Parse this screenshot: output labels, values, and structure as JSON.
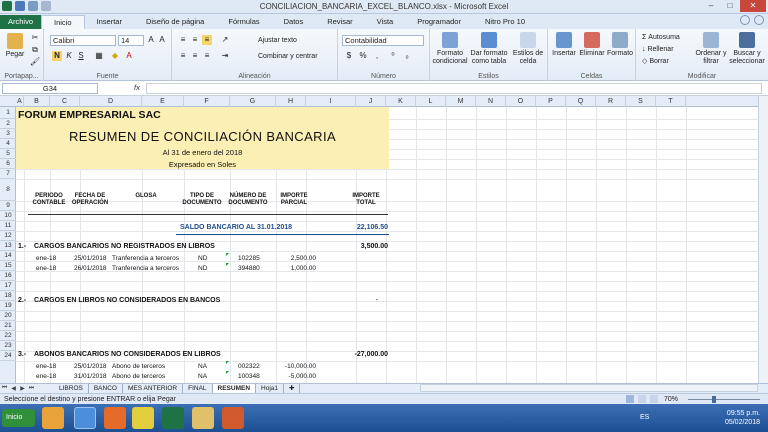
{
  "window": {
    "title": "CONCILIACION_BANCARIA_EXCEL_BLANCO.xlsx - Microsoft Excel",
    "minimize": "–",
    "maximize": "□",
    "close": "✕"
  },
  "tabs": [
    "Inicio",
    "Insertar",
    "Diseño de página",
    "Fórmulas",
    "Datos",
    "Revisar",
    "Vista",
    "Programador",
    "Nitro Pro 10"
  ],
  "file_tab": "Archivo",
  "ribbon": {
    "clipboard": {
      "label": "Portapap...",
      "paste": "Pegar"
    },
    "font": {
      "label": "Fuente",
      "name": "Calibri",
      "size": "14",
      "bold": "N",
      "italic": "K",
      "underline": "S"
    },
    "alignment": {
      "label": "Alineación",
      "wrap": "Ajustar texto",
      "merge": "Combinar y centrar"
    },
    "number": {
      "label": "Número",
      "format": "Contabilidad"
    },
    "styles": {
      "label": "Estilos",
      "conditional": "Formato condicional",
      "table": "Dar formato como tabla",
      "cell": "Estilos de celda"
    },
    "cells": {
      "label": "Celdas",
      "insert": "Insertar",
      "delete": "Eliminar",
      "format": "Formato"
    },
    "editing": {
      "label": "Modificar",
      "autosum": "Autosuma",
      "fill": "Rellenar",
      "clear": "Borrar",
      "sort": "Ordenar y filtrar",
      "find": "Buscar y seleccionar"
    }
  },
  "formula_bar": {
    "name_box": "G34",
    "fx": "fx",
    "value": ""
  },
  "columns": [
    "A",
    "B",
    "C",
    "D",
    "E",
    "F",
    "G",
    "H",
    "I",
    "J",
    "K",
    "L",
    "M",
    "N",
    "O",
    "P",
    "Q",
    "R",
    "S",
    "T"
  ],
  "rows": [
    "1",
    "2",
    "3",
    "4",
    "5",
    "6",
    "7",
    "8",
    "9",
    "10",
    "11",
    "12",
    "13",
    "14",
    "15",
    "16",
    "17",
    "18",
    "19",
    "20",
    "21",
    "22",
    "23",
    "24"
  ],
  "sheet": {
    "company": "FORUM EMPRESARIAL SAC",
    "title": "RESUMEN DE CONCILIACIÓN BANCARIA",
    "date": "Al 31 de enero del 2018",
    "currency": "Expresado en Soles",
    "headers": {
      "periodo": "PERIODO CONTABLE",
      "fecha": "FECHA DE OPERACIÓN",
      "glosa": "GLOSA",
      "tipo": "TIPO DE DOCUMENTO",
      "numero": "NÚMERO DE DOCUMENTO",
      "parcial": "IMPORTE PARCIAL",
      "total": "IMPORTE TOTAL"
    },
    "saldo_label": "SALDO BANCARIO AL 31.01.2018",
    "saldo_value": "22,106.50",
    "s1_num": "1.-",
    "s1_label": "CARGOS BANCARIOS NO REGISTRADOS EN LIBROS",
    "s1_total": "3,500.00",
    "s1_rows": [
      {
        "periodo": "ene-18",
        "fecha": "25/01/2018",
        "glosa": "Tranferencia a terceros",
        "tipo": "ND",
        "numero": "102285",
        "parcial": "2,500.00"
      },
      {
        "periodo": "ene-18",
        "fecha": "26/01/2018",
        "glosa": "Tranferencia a terceros",
        "tipo": "ND",
        "numero": "394880",
        "parcial": "1,000.00"
      }
    ],
    "s2_num": "2.-",
    "s2_label": "CARGOS EN LIBROS NO CONSIDERADOS EN BANCOS",
    "s2_total": "-",
    "s3_num": "3.-",
    "s3_label": "ABONOS BANCARIOS NO CONSIDERADOS EN LIBROS",
    "s3_total": "-27,000.00",
    "s3_rows": [
      {
        "periodo": "ene-18",
        "fecha": "25/01/2018",
        "glosa": "Abono de terceros",
        "tipo": "NA",
        "numero": "002322",
        "parcial": "-10,000.00"
      },
      {
        "periodo": "ene-18",
        "fecha": "31/01/2018",
        "glosa": "Abono de terceros",
        "tipo": "NA",
        "numero": "100348",
        "parcial": "-5,000.00"
      }
    ]
  },
  "sheet_tabs": [
    "LIBROS",
    "BANCO",
    "MES ANTERIOR",
    "FINAL",
    "RESUMEN",
    "Hoja1"
  ],
  "active_sheet": "RESUMEN",
  "status": {
    "message": "Seleccione el destino y presione ENTRAR o elija Pegar",
    "zoom": "70%"
  },
  "taskbar": {
    "start": "Inicio",
    "lang": "ES",
    "time": "09:55 p.m.",
    "date": "05/02/2018"
  }
}
